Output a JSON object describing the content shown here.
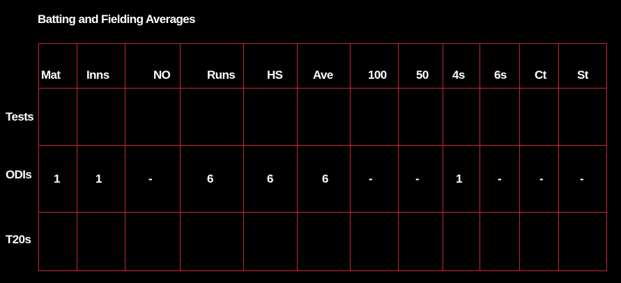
{
  "title": "Batting and Fielding Averages",
  "columns": [
    "Mat",
    "Inns",
    "NO",
    "Runs",
    "HS",
    "Ave",
    "100",
    "50",
    "4s",
    "6s",
    "Ct",
    "St"
  ],
  "rows": [
    {
      "label": "Tests",
      "values": [
        "",
        "",
        "",
        "",
        "",
        "",
        "",
        "",
        "",
        "",
        "",
        ""
      ]
    },
    {
      "label": "ODIs",
      "values": [
        "1",
        "1",
        "-",
        "6",
        "6",
        "6",
        "-",
        "-",
        "1",
        "-",
        "-",
        "-"
      ]
    },
    {
      "label": "T20s",
      "values": [
        "",
        "",
        "",
        "",
        "",
        "",
        "",
        "",
        "",
        "",
        "",
        ""
      ]
    }
  ],
  "colors": {
    "background": "#000000",
    "text": "#ffffff",
    "grid": "#c8263a"
  }
}
